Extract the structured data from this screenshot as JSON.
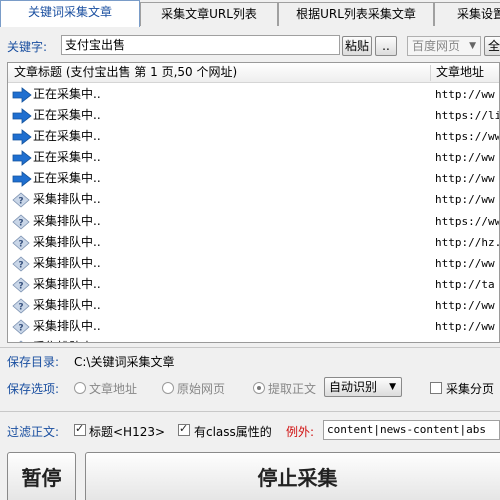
{
  "tabs": [
    {
      "label": "关键词采集文章",
      "active": true
    },
    {
      "label": "采集文章URL列表",
      "active": false
    },
    {
      "label": "根据URL列表采集文章",
      "active": false
    },
    {
      "label": "采集设置",
      "active": false
    }
  ],
  "keyword": {
    "label": "关键字:",
    "value": "支付宝出售",
    "paste_label": "粘贴",
    "more_label": "..",
    "source_selected": "百度网页",
    "all_label": "全"
  },
  "list": {
    "col_title": "文章标题 (支付宝出售 第 1 页,50 个网址)",
    "col_url": "文章地址",
    "rows": [
      {
        "status": "正在采集中..",
        "url": "http://ww",
        "icon": "arrow-right-icon"
      },
      {
        "status": "正在采集中..",
        "url": "https://li",
        "icon": "arrow-right-icon"
      },
      {
        "status": "正在采集中..",
        "url": "https://ww",
        "icon": "arrow-right-icon"
      },
      {
        "status": "正在采集中..",
        "url": "http://ww",
        "icon": "arrow-right-icon"
      },
      {
        "status": "正在采集中..",
        "url": "http://ww",
        "icon": "arrow-right-icon"
      },
      {
        "status": "采集排队中..",
        "url": "http://ww",
        "icon": "question-icon"
      },
      {
        "status": "采集排队中..",
        "url": "https://ww",
        "icon": "question-icon"
      },
      {
        "status": "采集排队中..",
        "url": "http://hz.",
        "icon": "question-icon"
      },
      {
        "status": "采集排队中..",
        "url": "http://ww",
        "icon": "question-icon"
      },
      {
        "status": "采集排队中..",
        "url": "http://ta",
        "icon": "question-icon"
      },
      {
        "status": "采集排队中..",
        "url": "http://ww",
        "icon": "question-icon"
      },
      {
        "status": "采集排队中..",
        "url": "http://ww",
        "icon": "question-icon"
      },
      {
        "status": "采集排队中..",
        "url": "http://ww",
        "icon": "question-icon"
      }
    ]
  },
  "save_dir": {
    "label": "保存目录:",
    "value": "C:\\关键词采集文章"
  },
  "save_options": {
    "label": "保存选项:",
    "opt1": "文章地址",
    "opt2": "原始网页",
    "opt3": "提取正文",
    "mode_selected": "自动识别",
    "paging_label": "采集分页"
  },
  "filter": {
    "label": "过滤正文:",
    "title_check": "标题<H123>",
    "class_check": "有class属性的",
    "except_label": "例外:",
    "except_value": "content|news-content|abs"
  },
  "actions": {
    "pause_label": "暂停",
    "stop_label": "停止采集"
  },
  "colors": {
    "accent_blue": "#1a4fa0",
    "arrow_blue": "#1f6fd0",
    "red_label": "#d01010"
  }
}
